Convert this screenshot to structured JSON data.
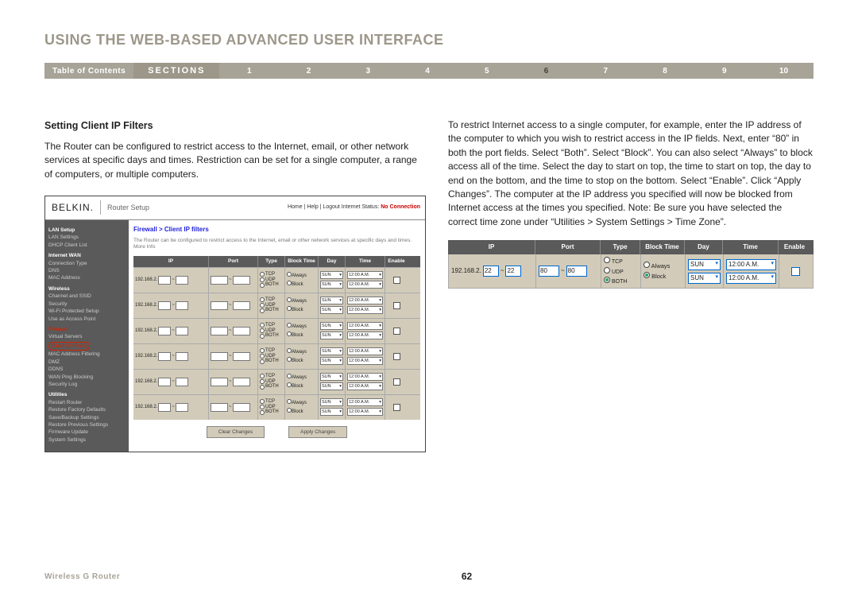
{
  "page_title": "USING THE WEB-BASED ADVANCED USER INTERFACE",
  "toc_label": "Table of Contents",
  "sections_label": "SECTIONS",
  "section_numbers": [
    "1",
    "2",
    "3",
    "4",
    "5",
    "6",
    "7",
    "8",
    "9",
    "10"
  ],
  "active_section_index": 5,
  "subhead": "Setting Client IP Filters",
  "left_para": "The Router can be configured to restrict access to the Internet, email, or other network services at specific days and times. Restriction can be set for a single computer, a range of computers, or multiple computers.",
  "right_para": "To restrict Internet access to a single computer, for example, enter the IP address of the computer to which you wish to restrict access in the IP fields. Next, enter “80” in both the port fields. Select “Both”. Select “Block”. You can also select “Always” to block access all of the time. Select the day to start on top, the time to start on top, the day to end on the bottom, and the time to stop on the bottom. Select “Enable”. Click “Apply Changes”. The computer at the IP address you specified will now be blocked from Internet access at the times you specified. Note: Be sure you have selected the correct time zone under “Utilities > System Settings > Time Zone”.",
  "router": {
    "logo": "BELKIN.",
    "title": "Router Setup",
    "top_links": "Home | Help | Logout  Internet Status:",
    "top_status": "No Connection",
    "breadcrumb": "Firewall > Client IP filters",
    "desc": "The Router can be configured to restrict access to the Internet, email or other network services at specific days and times. More Info",
    "nav": {
      "g1": "LAN Setup",
      "g1a": "LAN Settings",
      "g1b": "DHCP Client List",
      "g2": "Internet WAN",
      "g2a": "Connection Type",
      "g2b": "DNS",
      "g2c": "MAC Address",
      "g3": "Wireless",
      "g3a": "Channel and SSID",
      "g3b": "Security",
      "g3c": "Wi-Fi Protected Setup",
      "g3d": "Use as Access Point",
      "g4": "Firewall",
      "g4a": "Virtual Servers",
      "g4b": "Client IP Filters",
      "g4c": "MAC Address Filtering",
      "g4d": "DMZ",
      "g4e": "DDNS",
      "g4f": "WAN Ping Blocking",
      "g4g": "Security Log",
      "g5": "Utilities",
      "g5a": "Restart Router",
      "g5b": "Restore Factory Defaults",
      "g5c": "Save/Backup Settings",
      "g5d": "Restore Previous Settings",
      "g5e": "Firmware Update",
      "g5f": "System Settings"
    },
    "table_head": {
      "ip": "IP",
      "port": "Port",
      "type": "Type",
      "bt": "Block Time",
      "day": "Day",
      "time": "Time",
      "en": "Enable"
    },
    "rows": [
      {
        "ip": "192.168.2."
      },
      {
        "ip": "192.168.2."
      },
      {
        "ip": "192.168.2."
      },
      {
        "ip": "192.168.2."
      },
      {
        "ip": "192.168.2."
      },
      {
        "ip": "192.168.2."
      }
    ],
    "type_opts": {
      "tcp": "TCP",
      "udp": "UDP",
      "both": "BOTH"
    },
    "bt_opts": {
      "always": "Always",
      "block": "Block"
    },
    "day_val": "SUN",
    "time_val": "12:00 A.M.",
    "btn1": "Clear Changes",
    "btn2": "Apply Changes"
  },
  "zoom": {
    "head": {
      "ip": "IP",
      "port": "Port",
      "type": "Type",
      "bt": "Block Time",
      "day": "Day",
      "time": "Time",
      "en": "Enable"
    },
    "ip_prefix": "192.168.2.",
    "ip_a": "22",
    "ip_b": "22",
    "port_a": "80",
    "port_b": "80",
    "tcp": "TCP",
    "udp": "UDP",
    "both": "BOTH",
    "always": "Always",
    "block": "Block",
    "day": "SUN",
    "time": "12:00 A.M."
  },
  "footer_product": "Wireless G Router",
  "page_number": "62"
}
